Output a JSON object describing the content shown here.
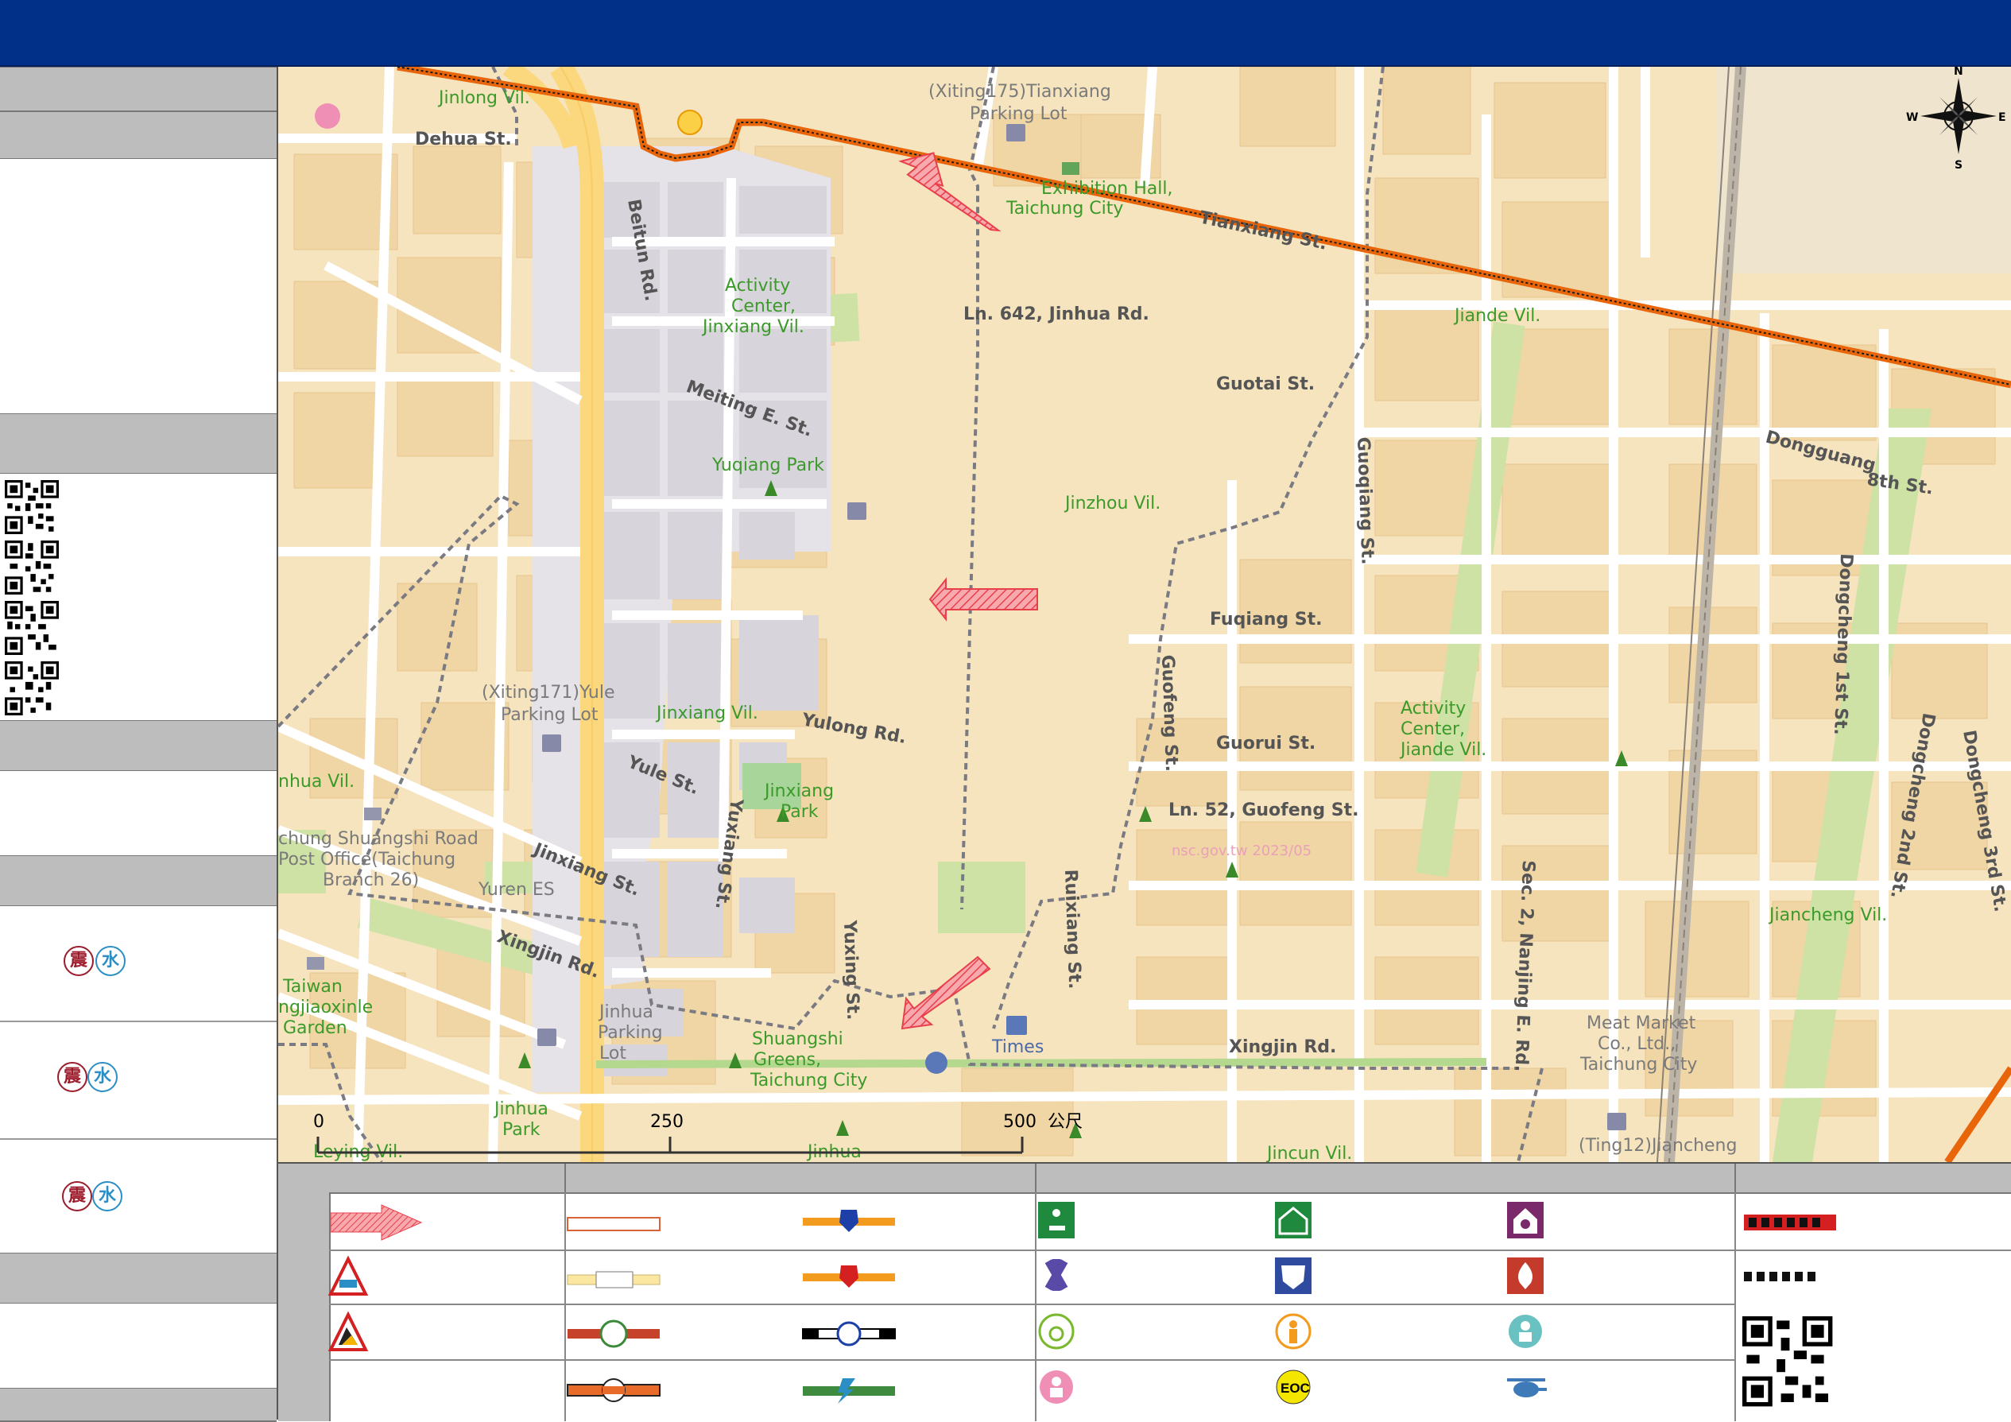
{
  "map": {
    "labels": {
      "village_jinlong": "Jinlong Vil.",
      "dehua_st": "Dehua St.",
      "parking_xiting175": "(Xiting175)Tianxiang",
      "parking_xiting175_2": "Parking Lot",
      "jincun_fragment": "Jincun",
      "exhibition_hall": "Exhibition Hall,",
      "exhibition_hall_2": "Taichung City",
      "tianxiang_st": "Tianxiang St.",
      "beitun_rd": "Beitun Rd.",
      "activity_center_jinxiang": "Activity",
      "activity_center_jinxiang_2": "Center,",
      "activity_center_jinxiang_3": "Jinxiang Vil.",
      "ln642_jinhua": "Ln. 642, Jinhua Rd.",
      "jiande_vil": "Jiande Vil.",
      "guotai_st": "Guotai St.",
      "meiting_e_st": "Meiting E. St.",
      "yuqiang_park": "Yuqiang Park",
      "jinzhou_vil": "Jinzhou Vil.",
      "guoqiang_st": "Guoqiang St.",
      "dongguang_8th": "Dongguang",
      "dongguang_8th_2": "8th St.",
      "fuqiang_st": "Fuqiang St.",
      "dongcheng_1st": "Dongcheng 1st St.",
      "parking_xiting171": "(Xiting171)Yule",
      "parking_xiting171_2": "Parking Lot",
      "jinxiang_vil": "Jinxiang Vil.",
      "yulong_rd": "Yulong Rd.",
      "guofeng_st": "Guofeng St.",
      "guorui_st": "Guorui St.",
      "activity_center_jiande": "Activity",
      "activity_center_jiande_2": "Center,",
      "activity_center_jiande_3": "Jiande Vil.",
      "dongcheng_2nd": "Dongcheng 2nd St.",
      "dongcheng_3rd": "Dongcheng 3rd St.",
      "jinhua_vil": "nhua Vil.",
      "yule_st": "Yule St.",
      "jinxiang_park": "Jinxiang",
      "jinxiang_park_2": "Park",
      "ln52_guofeng": "Ln. 52, Guofeng St.",
      "post_office": "chung Shuangshi Road",
      "post_office_2": "Post Office(Taichung",
      "post_office_3": "Branch 26)",
      "jinxiang_st": "Jinxiang St.",
      "yuxiang_st": "Yuxiang St.",
      "yuren_es": "Yuren ES",
      "ruixiang_st": "Ruixiang St.",
      "nanjing_e_rd": "Sec. 2, Nanjing E. Rd.",
      "jiancheng_vil": "Jiancheng Vil.",
      "xingjin_rd_w": "Xingjin Rd.",
      "yuxing_st": "Yuxing St.",
      "taiwan_garden": "Taiwan",
      "taiwan_garden_2": "ngjiaoxinle",
      "taiwan_garden_3": "Garden",
      "jinhua_parking": "Jinhua",
      "jinhua_parking_2": "Parking",
      "jinhua_parking_3": "Lot",
      "shuangshi_greens": "Shuangshi",
      "shuangshi_greens_2": "Greens,",
      "shuangshi_greens_3": "Taichung City",
      "times": "Times",
      "xingjin_rd_e": "Xingjin Rd.",
      "meat_market": "Meat Market",
      "meat_market_2": "Co., Ltd.,",
      "meat_market_3": "Taichung City",
      "jinhua_park": "Jinhua",
      "jinhua_park_2": "Park",
      "leying_vil": "Leying Vil.",
      "jinhua_bottom": "Jinhua",
      "jincun_vil": "Jincun Vil.",
      "ting12": "(Ting12)Jiancheng",
      "watermark": "nsc.gov.tw 2023/05"
    },
    "scalebar": {
      "ticks": [
        "0",
        "250",
        "500"
      ],
      "unit": "公尺"
    },
    "compass": {
      "n": "N",
      "s": "S",
      "e": "E",
      "w": "W"
    }
  },
  "sidebar": {
    "hazard_glyphs": {
      "quake": "震",
      "water": "水"
    }
  },
  "legend": {
    "special_icon": "EOC"
  },
  "colors": {
    "title_bar": "#003087",
    "map_land": "#f6e4bf",
    "block": "#f0d6a5",
    "district": "#e5e2e8",
    "boundary_orange": "#e8650a",
    "arrow": "#e8404a",
    "green_label": "#3b9a2a"
  }
}
